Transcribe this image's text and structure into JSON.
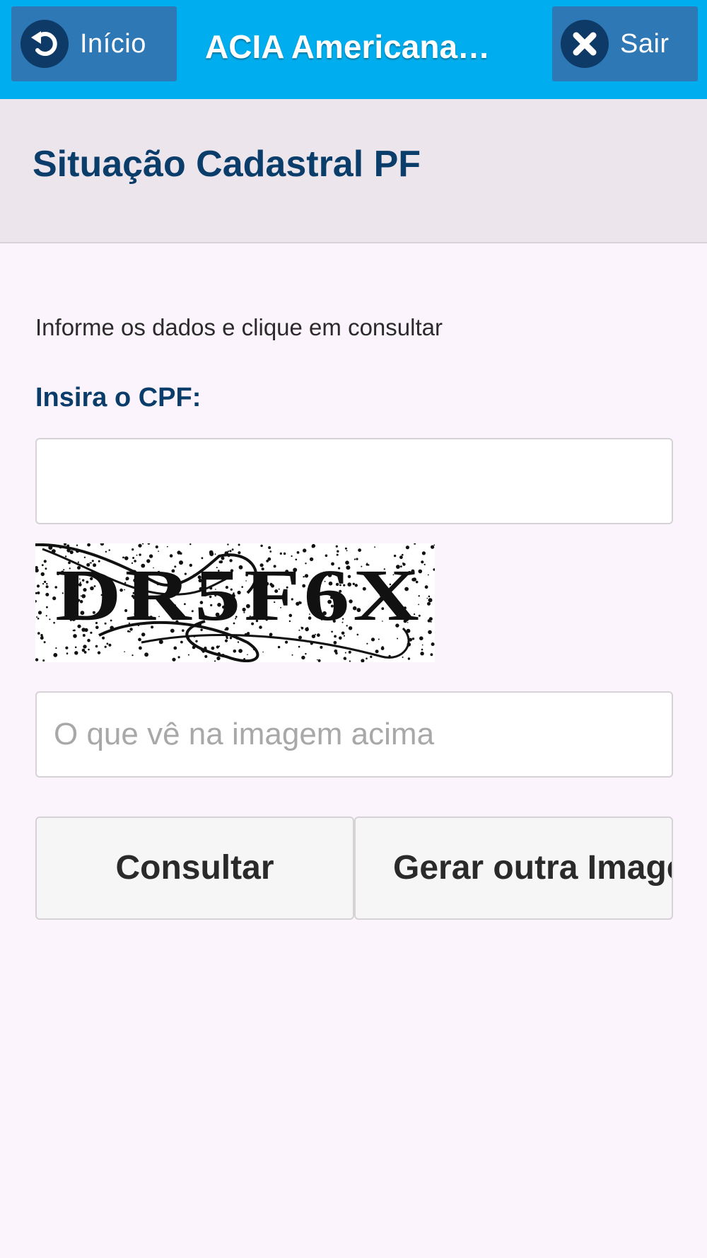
{
  "topbar": {
    "back_label": "Início",
    "title": "ACIA Americana…",
    "exit_label": "Sair",
    "back_icon": "back-arrow-icon",
    "exit_icon": "close-icon",
    "bar_color": "#00aeef",
    "button_color": "#2e78b6"
  },
  "header": {
    "title": "Situação Cadastral PF"
  },
  "form": {
    "instruction": "Informe os dados e clique em consultar",
    "cpf_label": "Insira o CPF:",
    "cpf_value": "",
    "captcha_text": "DR5F6X",
    "captcha_placeholder": "O que vê na imagem acima",
    "captcha_value": ""
  },
  "actions": {
    "submit_label": "Consultar",
    "regenerate_label": "Gerar outra Imagem"
  },
  "colors": {
    "title_blue": "#0b3d6b",
    "page_background": "#fcf4fc",
    "header_background": "#ece6ec"
  }
}
